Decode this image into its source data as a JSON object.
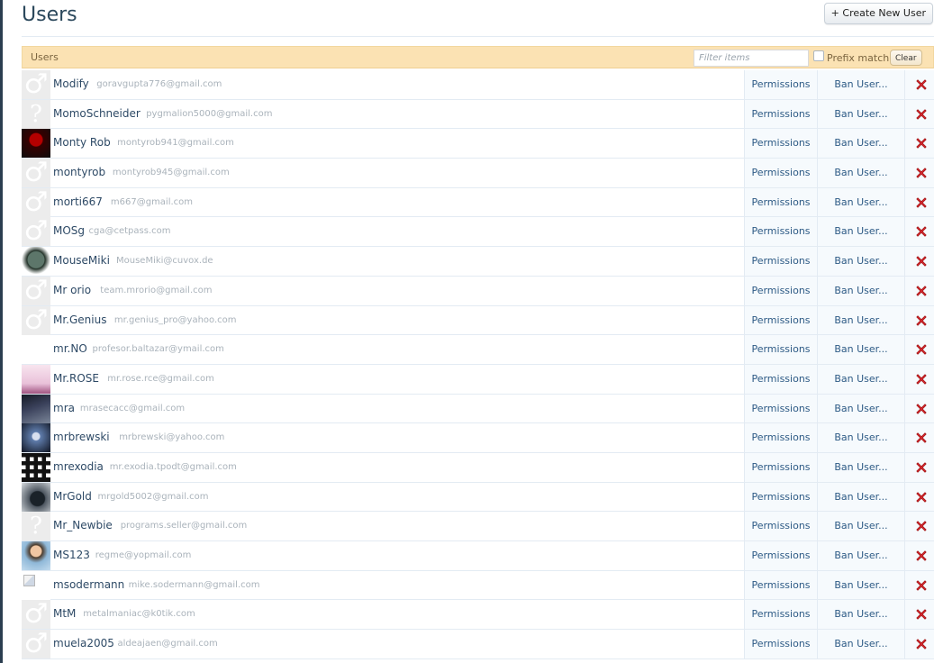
{
  "page": {
    "title": "Users",
    "create_button_label": "+ Create New User"
  },
  "toolbar": {
    "label": "Users",
    "filter_placeholder": "Filter items",
    "prefix_match_label": "Prefix match",
    "prefix_match_checked": false,
    "clear_label": "Clear"
  },
  "actions": {
    "permissions_label": "Permissions",
    "ban_label": "Ban User...",
    "delete_icon": "delete-icon",
    "delete_color": "#d9272e"
  },
  "users": [
    {
      "username": "Modify",
      "email": "goravgupta776@gmail.com",
      "avatar": "male"
    },
    {
      "username": "MomoSchneider",
      "email": "pygmalion5000@gmail.com",
      "avatar": "unknown"
    },
    {
      "username": "Monty Rob",
      "email": "montyrob941@gmail.com",
      "avatar": "photo-red"
    },
    {
      "username": "montyrob",
      "email": "montyrob945@gmail.com",
      "avatar": "male"
    },
    {
      "username": "morti667",
      "email": "m667@gmail.com",
      "avatar": "male"
    },
    {
      "username": "MOSg",
      "email": "cga@cetpass.com",
      "avatar": "male"
    },
    {
      "username": "MouseMiki",
      "email": "MouseMiki@cuvox.de",
      "avatar": "photo-gasmask"
    },
    {
      "username": "Mr orio",
      "email": "team.mrorio@gmail.com",
      "avatar": "male"
    },
    {
      "username": "Mr.Genius",
      "email": "mr.genius_pro@yahoo.com",
      "avatar": "male"
    },
    {
      "username": "mr.NO",
      "email": "profesor.baltazar@ymail.com",
      "avatar": "blank"
    },
    {
      "username": "Mr.ROSE",
      "email": "mr.rose.rce@gmail.com",
      "avatar": "photo-pink"
    },
    {
      "username": "mra",
      "email": "mrasecacc@gmail.com",
      "avatar": "photo-dark"
    },
    {
      "username": "mrbrewski",
      "email": "mrbrewski@yahoo.com",
      "avatar": "photo-warrior"
    },
    {
      "username": "mrexodia",
      "email": "mr.exodia.tpodt@gmail.com",
      "avatar": "photo-qr"
    },
    {
      "username": "MrGold",
      "email": "mrgold5002@gmail.com",
      "avatar": "photo-mrgold"
    },
    {
      "username": "Mr_Newbie",
      "email": "programs.seller@gmail.com",
      "avatar": "unknown"
    },
    {
      "username": "MS123",
      "email": "regme@yopmail.com",
      "avatar": "photo-person"
    },
    {
      "username": "msodermann",
      "email": "mike.sodermann@gmail.com",
      "avatar": "broken"
    },
    {
      "username": "MtM",
      "email": "metalmaniac@k0tik.com",
      "avatar": "male"
    },
    {
      "username": "muela2005",
      "email": "aldeajaen@gmail.com",
      "avatar": "male"
    }
  ]
}
